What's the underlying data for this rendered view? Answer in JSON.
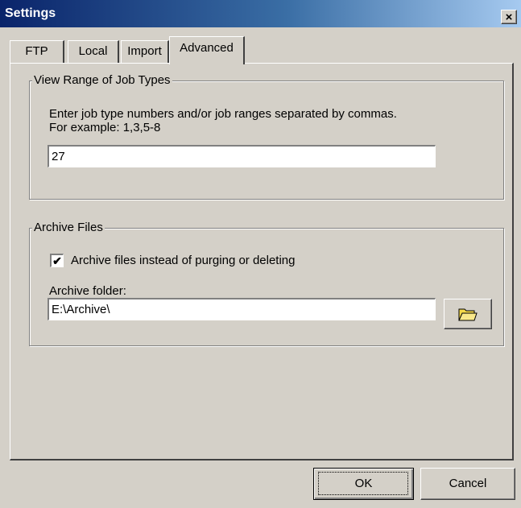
{
  "window": {
    "title": "Settings",
    "close_label": "×"
  },
  "tabs": [
    {
      "label": "FTP"
    },
    {
      "label": "Local"
    },
    {
      "label": "Import"
    },
    {
      "label": "Advanced",
      "selected": true
    }
  ],
  "job_types": {
    "group_label": "View Range of Job Types",
    "instructions_line1": "Enter job type numbers and/or job ranges separated by commas.",
    "instructions_line2": "For example:  1,3,5-8",
    "value": "27"
  },
  "archive": {
    "group_label": "Archive Files",
    "checkbox_label": "Archive files instead of purging or deleting",
    "checkbox_checked": true,
    "checkbox_mark": "✔",
    "folder_label": "Archive folder:",
    "folder_value": "E:\\Archive\\",
    "browse_icon": "folder-open-icon"
  },
  "footer": {
    "ok_label": "OK",
    "cancel_label": "Cancel"
  }
}
